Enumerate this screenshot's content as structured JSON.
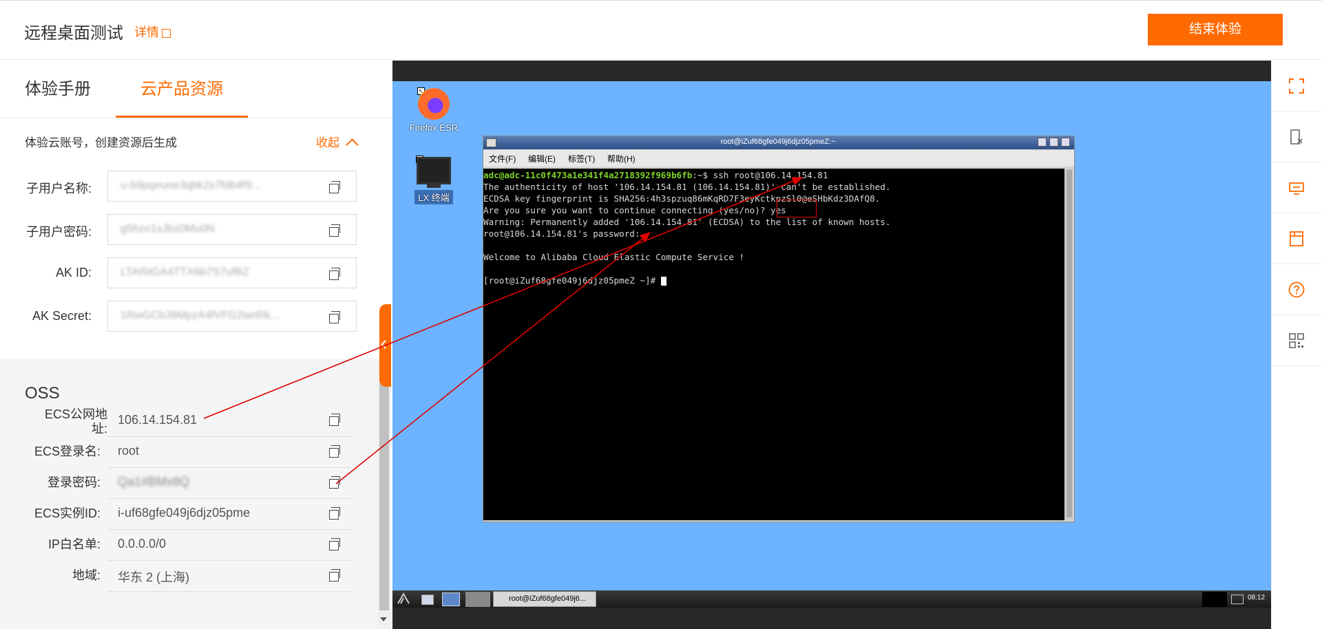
{
  "header": {
    "title": "远程桌面测试",
    "details_link": "详情",
    "end_button": "结束体验"
  },
  "tabs": [
    {
      "label": "体验手册"
    },
    {
      "label": "云产品资源",
      "active": true
    }
  ],
  "account_section": {
    "note": "体验云账号，创建资源后生成",
    "collapse_label": "收起",
    "fields": [
      {
        "label": "子用户名称:",
        "value": "u-b9pqeune3qbk2s7fdb4f9..."
      },
      {
        "label": "子用户密码:",
        "value": "g5hze1sJbz0Mu0N"
      },
      {
        "label": "AK ID:",
        "value": "LTAI5tGA4TTX6b7S7ufBZ"
      },
      {
        "label": "AK Secret:",
        "value": "1RwGCbJ9MpzA4fVFG2wnRk..."
      }
    ]
  },
  "oss_section": {
    "title": "OSS",
    "rows": [
      {
        "label": "ECS公网地址:",
        "value": "106.14.154.81"
      },
      {
        "label": "ECS登录名:",
        "value": "root"
      },
      {
        "label": "登录密码:",
        "value": "Qa1#BMx8Q"
      },
      {
        "label": "ECS实例ID:",
        "value": "i-uf68gfe049j6djz05pme"
      },
      {
        "label": "IP白名单:",
        "value": "0.0.0.0/0"
      },
      {
        "label": "地域:",
        "value": "华东 2 (上海)"
      }
    ]
  },
  "desktop": {
    "icons": [
      {
        "name": "firefox",
        "label": "Firefox ESR"
      },
      {
        "name": "terminal",
        "label": "LX 终端"
      }
    ],
    "terminal": {
      "window_title": "root@iZuf68gfe049j6djz05pmeZ:~",
      "menu": [
        "文件(F)",
        "编辑(E)",
        "标签(T)",
        "帮助(H)"
      ],
      "lines": [
        {
          "prompt": "adc@adc-11c0f473a1e341f4a2718392f969b6fb",
          "text": ":~$ ssh root@106.14.154.81"
        },
        {
          "text": "The authenticity of host '106.14.154.81 (106.14.154.81)' can't be established."
        },
        {
          "text": "ECDSA key fingerprint is SHA256:4h3spzuq86mKqRD7F3eyKctkpzSl0@eSHbKdz3DAfQ8."
        },
        {
          "text": "Are you sure you want to continue connecting (yes/no)? yes"
        },
        {
          "text": "Warning: Permanently added '106.14.154.81' (ECDSA) to the list of known hosts."
        },
        {
          "text": "root@106.14.154.81's password:"
        },
        {
          "text": ""
        },
        {
          "text": "Welcome to Alibaba Cloud Elastic Compute Service !"
        },
        {
          "text": ""
        },
        {
          "text": "[root@iZuf68gfe049j6djz05pmeZ ~]# "
        }
      ]
    },
    "taskbar": {
      "task_label": "root@iZuf68gfe049j6...",
      "clock": "08:12"
    }
  },
  "right_rail": [
    "fullscreen-icon",
    "clipboard-x-icon",
    "screen-share-icon",
    "bookmark-icon",
    "help-icon",
    "qrcode-icon"
  ],
  "colors": {
    "accent": "#ff6a00",
    "desktop": "#6db3ff",
    "arrow": "#e00000"
  }
}
